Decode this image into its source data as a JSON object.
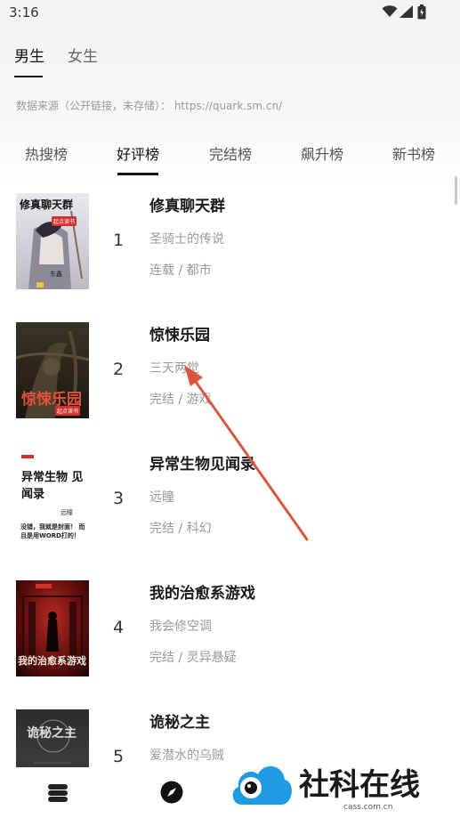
{
  "status_bar": {
    "time": "3:16"
  },
  "gender_tabs": [
    {
      "label": "男生"
    },
    {
      "label": "女生"
    }
  ],
  "source_note": "数据来源（公开链接，未存储）： https://quark.sm.cn/",
  "rank_tabs": [
    {
      "label": "热搜榜"
    },
    {
      "label": "好评榜"
    },
    {
      "label": "完结榜"
    },
    {
      "label": "飙升榜"
    },
    {
      "label": "新书榜"
    }
  ],
  "books": [
    {
      "rank": "1",
      "title": "修真聊天群",
      "author": "圣骑士的传说",
      "meta": "连载 / 都市",
      "cover_text": "修真聊天群",
      "cover_badge": "起点读书",
      "cover_extra": "东鑫"
    },
    {
      "rank": "2",
      "title": "惊悚乐园",
      "author": "三天两觉",
      "meta": "完结 / 游戏",
      "cover_text": "惊悚乐园",
      "cover_badge": "起点读书",
      "cover_extra": ""
    },
    {
      "rank": "3",
      "title": "异常生物见闻录",
      "author": "远瞳",
      "meta": "完结 / 科幻",
      "cover_text": "异常生物 见闻录",
      "cover_badge": "远瞳",
      "cover_extra": "没错，我就是封面！ 而且是用WORD打的！"
    },
    {
      "rank": "4",
      "title": "我的治愈系游戏",
      "author": "我会修空调",
      "meta": "完结 / 灵异悬疑",
      "cover_text": "我的治愈系游戏",
      "cover_badge": "",
      "cover_extra": ""
    },
    {
      "rank": "5",
      "title": "诡秘之主",
      "author": "爱潜水的乌贼",
      "meta": "",
      "cover_text": "诡秘之主",
      "cover_badge": "",
      "cover_extra": ""
    }
  ],
  "watermark": {
    "text": "社科在线",
    "url": "cass.com.cn"
  },
  "colors": {
    "annotation_arrow": "#d9573f",
    "cover4_red": "#b3201d",
    "watermark_blue": "#1e9be3"
  },
  "icons": [
    "wifi-icon",
    "signal-icon",
    "battery-icon",
    "bookshelf-icon",
    "compass-icon"
  ]
}
